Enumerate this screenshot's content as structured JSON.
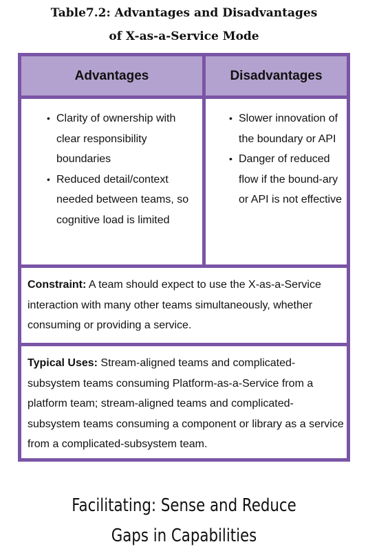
{
  "caption": {
    "line1": "Table7.2: Advantages and Disadvantages",
    "line2": "of X-as-a-Service Mode"
  },
  "table": {
    "headers": [
      "Advantages",
      "Disadvantages"
    ],
    "advantages": [
      "Clarity of ownership with clear responsibility boundaries",
      "Reduced detail/context needed between teams, so cognitive load is limited"
    ],
    "disadvantages": [
      "Slower innovation of the boundary or API",
      "Danger of reduced flow if the bound-ary or API is not effective"
    ],
    "constraint": {
      "label": "Constraint:",
      "text": "A team should expect to use the X-as-a-Service interaction with many other teams simultaneously, whether consuming or providing a service."
    },
    "typical_uses": {
      "label": "Typical Uses:",
      "text": "Stream-aligned teams and complicated-subsystem teams consuming Platform-as-a-Service from a platform team; stream-aligned teams and complicated-subsystem teams consuming a component or library as a service from a complicated-subsystem team."
    }
  },
  "section_heading": {
    "line1": "Facilitating: Sense and Reduce",
    "line2": "Gaps in Capabilities"
  },
  "colors": {
    "border": "#7a55a6",
    "header_fill": "#b3a2cf"
  }
}
